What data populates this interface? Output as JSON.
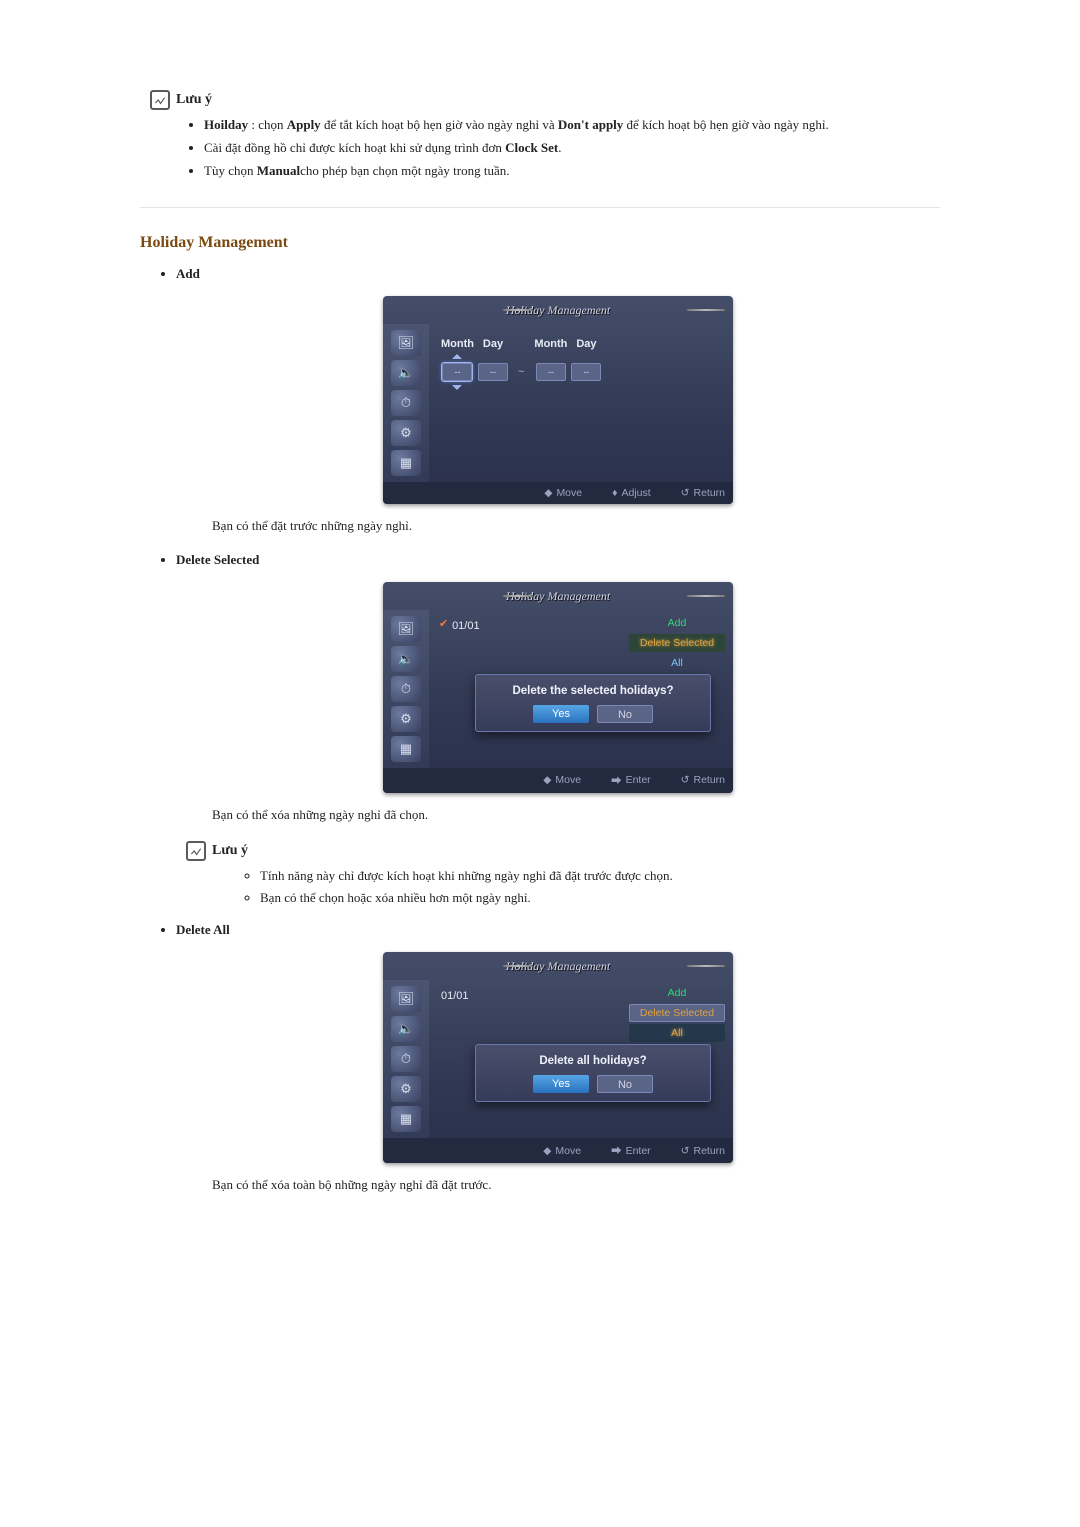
{
  "note_top": {
    "title": "Lưu ý",
    "items": {
      "l1_pre": "Hoilday",
      "l1_mid1": " : chọn ",
      "l1_apply": "Apply",
      "l1_mid2": " để tắt kích hoạt bộ hẹn giờ vào ngày nghỉ và ",
      "l1_dont": "Don't apply",
      "l1_end": " để kích hoạt bộ hẹn giờ vào ngày nghỉ.",
      "l2_pre": "Cài đặt đồng hồ chỉ được kích hoạt khi sử dụng trình đơn ",
      "l2_bold": "Clock Set",
      "l2_end": ".",
      "l3_pre": "Tùy chọn ",
      "l3_bold": "Manual",
      "l3_end": "cho phép bạn chọn một ngày trong tuần."
    }
  },
  "section_title": "Holiday Management",
  "add": {
    "label": "Add",
    "desc": "Bạn có thể đặt trước những ngày nghỉ.",
    "osd_title": "Holiday Management",
    "month": "Month",
    "day": "Day",
    "dash": "--",
    "tilde": "~",
    "foot_move": "Move",
    "foot_adjust": "Adjust",
    "foot_return": "Return"
  },
  "delsel": {
    "label": "Delete Selected",
    "desc": "Bạn có thể xóa những ngày nghỉ đã chọn.",
    "osd_title": "Holiday Management",
    "row_date": "01/01",
    "act_add": "Add",
    "act_sel": "Delete Selected",
    "act_all": "All",
    "modal_q": "Delete the selected holidays?",
    "yes": "Yes",
    "no": "No",
    "foot_move": "Move",
    "foot_enter": "Enter",
    "foot_return": "Return",
    "note_title": "Lưu ý",
    "note_items": {
      "a": "Tính năng này chỉ được kích hoạt khi những ngày nghỉ đã đặt trước được chọn.",
      "b": "Bạn có thể chọn hoặc xóa nhiều hơn một ngày nghỉ."
    }
  },
  "delall": {
    "label": "Delete All",
    "desc": "Bạn có thể xóa toàn bộ những ngày nghỉ đã đặt trước.",
    "osd_title": "Holiday Management",
    "row_date": "01/01",
    "act_add": "Add",
    "act_sel": "Delete Selected",
    "act_all": "All",
    "modal_q": "Delete all holidays?",
    "yes": "Yes",
    "no": "No",
    "foot_move": "Move",
    "foot_enter": "Enter",
    "foot_return": "Return"
  }
}
